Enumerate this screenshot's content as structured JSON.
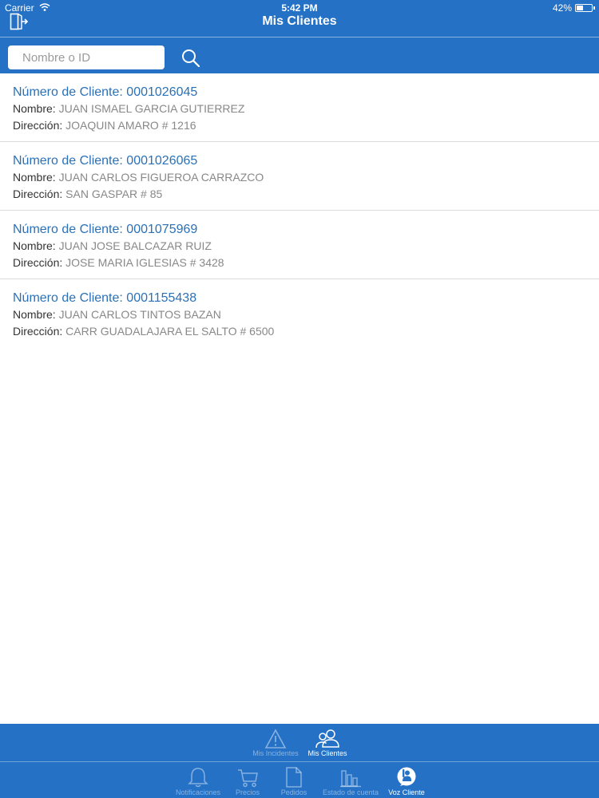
{
  "status_bar": {
    "carrier": "Carrier",
    "time": "5:42 PM",
    "battery": "42%"
  },
  "nav": {
    "title": "Mis Clientes"
  },
  "search": {
    "placeholder": "Nombre o ID"
  },
  "labels": {
    "number": "Número de Cliente: ",
    "name": "Nombre: ",
    "address": "Dirección: "
  },
  "clients": [
    {
      "number": "0001026045",
      "name": "JUAN ISMAEL GARCIA GUTIERREZ",
      "address": "JOAQUIN AMARO # 1216"
    },
    {
      "number": "0001026065",
      "name": "JUAN CARLOS FIGUEROA CARRAZCO",
      "address": "SAN GASPAR # 85"
    },
    {
      "number": "0001075969",
      "name": "JUAN JOSE BALCAZAR RUIZ",
      "address": "JOSE MARIA IGLESIAS # 3428"
    },
    {
      "number": "0001155438",
      "name": "JUAN CARLOS TINTOS BAZAN",
      "address": "CARR GUADALAJARA EL SALTO # 6500"
    }
  ],
  "subtabs": [
    {
      "label": "Mis Incidentes",
      "icon": "warning-icon",
      "active": false
    },
    {
      "label": "Mis Clientes",
      "icon": "people-icon",
      "active": true
    }
  ],
  "tabs": [
    {
      "label": "Notificaciones",
      "icon": "bell-icon",
      "active": false
    },
    {
      "label": "Precios",
      "icon": "cart-icon",
      "active": false
    },
    {
      "label": "Pedidos",
      "icon": "document-icon",
      "active": false
    },
    {
      "label": "Estado de cuenta",
      "icon": "chart-icon",
      "active": false
    },
    {
      "label": "Voz Cliente",
      "icon": "voice-client-icon",
      "active": true
    }
  ],
  "colors": {
    "primary": "#2471c6",
    "link": "#2a71b8",
    "value_text": "#888888",
    "divider": "#dcdcdc"
  }
}
